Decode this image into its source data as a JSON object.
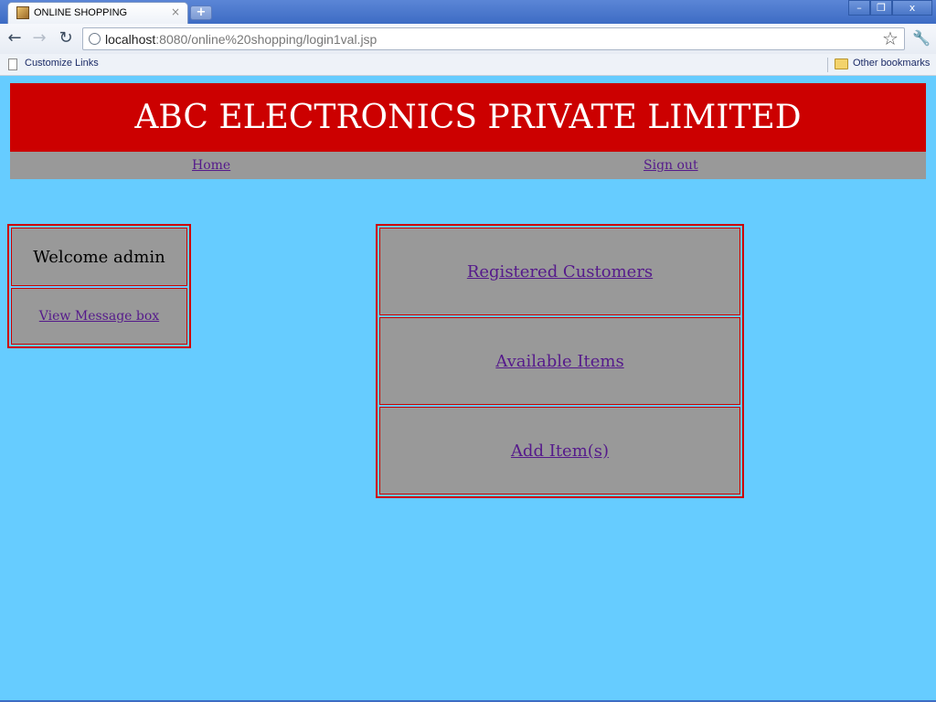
{
  "browser": {
    "tab_title": "ONLINE SHOPPING",
    "tab_close": "×",
    "new_tab": "+",
    "window_buttons": {
      "minimize": "–",
      "restore": "❐",
      "close": "x"
    },
    "url_host": "localhost",
    "url_rest": ":8080/online%20shopping/login1val.jsp",
    "bookmarks": {
      "customize_links": "Customize Links",
      "other_bookmarks": "Other bookmarks"
    }
  },
  "site": {
    "title": "ABC ELECTRONICS PRIVATE LIMITED",
    "nav": {
      "home": "Home",
      "sign_out": "Sign out"
    }
  },
  "sidebar": {
    "welcome": "Welcome admin",
    "message_link": "View Message box"
  },
  "menu": {
    "items": [
      {
        "label": "Registered Customers"
      },
      {
        "label": "Available Items"
      },
      {
        "label": "Add Item(s)"
      }
    ]
  },
  "colors": {
    "background": "#66ccff",
    "header": "#cc0000",
    "panel": "#999999",
    "link": "#551a8b"
  }
}
